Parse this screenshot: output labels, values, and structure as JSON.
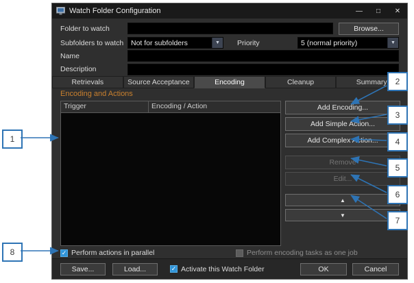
{
  "window": {
    "title": "Watch Folder Configuration",
    "minimize": "—",
    "maximize": "□",
    "close": "✕"
  },
  "form": {
    "folder_label": "Folder to watch",
    "folder_value": "",
    "browse": "Browse...",
    "subfolders_label": "Subfolders to watch",
    "subfolders_value": "Not for subfolders",
    "priority_label": "Priority",
    "priority_value": "5 (normal priority)",
    "name_label": "Name",
    "name_value": "",
    "description_label": "Description",
    "description_value": ""
  },
  "tabs": [
    {
      "label": "Retrievals",
      "active": false
    },
    {
      "label": "Source Acceptance",
      "active": false
    },
    {
      "label": "Encoding",
      "active": true
    },
    {
      "label": "Cleanup",
      "active": false
    },
    {
      "label": "Summary",
      "active": false
    }
  ],
  "encoding": {
    "section_title": "Encoding and Actions",
    "columns": [
      "Trigger",
      "Encoding / Action"
    ],
    "rows": [],
    "add_encoding": "Add Encoding...",
    "add_simple": "Add Simple Action...",
    "add_complex": "Add Complex Action...",
    "remove": "Remove",
    "edit": "Edit...",
    "move_up": "▲",
    "move_down": "▼",
    "parallel_label": "Perform actions in parallel",
    "parallel_checked": true,
    "one_job_label": "Perform encoding tasks as one job",
    "one_job_enabled": false
  },
  "footer": {
    "save": "Save...",
    "load": "Load...",
    "activate_label": "Activate this Watch Folder",
    "activate_checked": true,
    "ok": "OK",
    "cancel": "Cancel"
  },
  "icons": {
    "dropdown": "▼",
    "check": "✓"
  },
  "annotations": [
    "1",
    "2",
    "3",
    "4",
    "5",
    "6",
    "7",
    "8"
  ],
  "colors": {
    "annotation_blue": "#2e74b5",
    "accent_orange": "#c9802e",
    "checkbox_blue": "#3094d8"
  }
}
